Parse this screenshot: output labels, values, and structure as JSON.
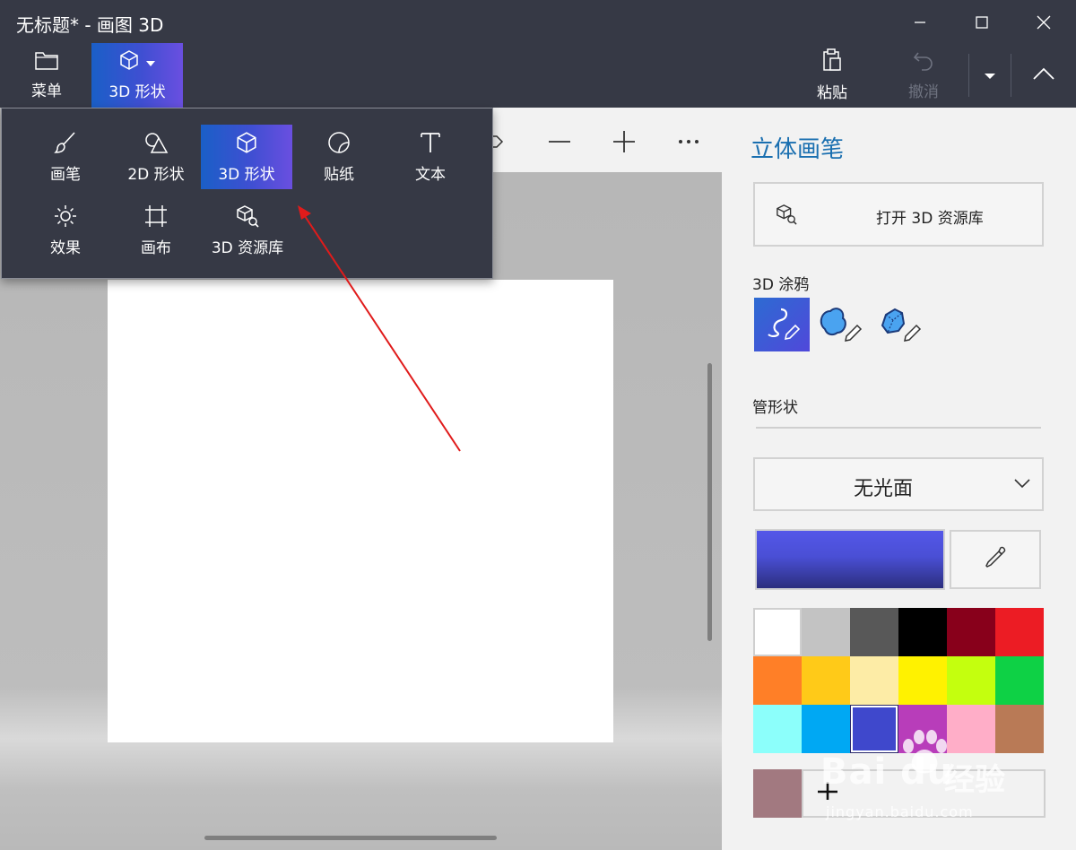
{
  "window": {
    "title": "无标题* - 画图 3D",
    "minimize_icon": "minimize-icon",
    "maximize_icon": "maximize-icon",
    "close_icon": "close-icon"
  },
  "toolbar": {
    "menu_label": "菜单",
    "shapes3d_label": "3D 形状",
    "paste_label": "粘贴",
    "undo_label": "撤消"
  },
  "dropdown": {
    "items": [
      {
        "label": "画笔",
        "icon": "brush-icon"
      },
      {
        "label": "2D 形状",
        "icon": "2d-shapes-icon"
      },
      {
        "label": "3D 形状",
        "icon": "3d-cube-icon",
        "active": true
      },
      {
        "label": "贴纸",
        "icon": "sticker-icon"
      },
      {
        "label": "文本",
        "icon": "text-icon"
      },
      {
        "label": "效果",
        "icon": "effects-sun-icon"
      },
      {
        "label": "画布",
        "icon": "canvas-crop-icon"
      },
      {
        "label": "3D 资源库",
        "icon": "3d-library-icon"
      }
    ]
  },
  "panel": {
    "title": "立体画笔",
    "library_button": "打开 3D 资源库",
    "doodle_section": "3D 涂鸦",
    "doodle_tools": [
      "tube-doodle-icon",
      "soft-doodle-icon",
      "sharp-doodle-icon"
    ],
    "tube_section": "管形状",
    "finish_value": "无光面"
  },
  "colors": {
    "accent_title": "#1a6fb0",
    "current": "#4a4fd5",
    "custom": "#a27980",
    "palette": [
      "#ffffff",
      "#c3c3c3",
      "#585858",
      "#000000",
      "#88001b",
      "#ec1c24",
      "#ff7f27",
      "#ffca18",
      "#fdeca6",
      "#fff200",
      "#c4ff0e",
      "#0ed145",
      "#8cfffb",
      "#00a8f3",
      "#3f48cc",
      "#b83dba",
      "#ffaec8",
      "#b97a56"
    ],
    "selected_index": 14
  },
  "watermark": {
    "logo": "Bai du",
    "cn": "经验",
    "url": "jingyan.baidu.com"
  }
}
